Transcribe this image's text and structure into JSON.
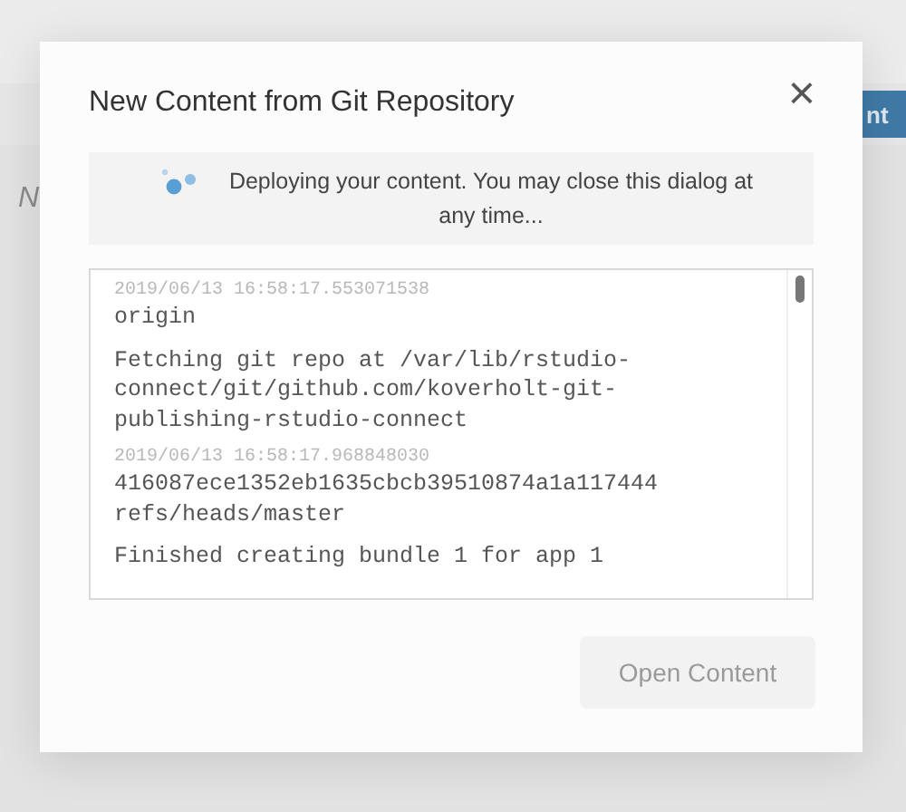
{
  "background": {
    "button_label": "nt",
    "text": "N"
  },
  "dialog": {
    "title": "New Content from Git Repository",
    "close": "×",
    "status": "Deploying your content. You may close this dialog at any time...",
    "log": [
      {
        "kind": "timestamp",
        "text": "2019/06/13 16:58:17.553071538"
      },
      {
        "kind": "message",
        "text": "origin"
      },
      {
        "kind": "message",
        "text": "Fetching git repo at /var/lib/rstudio-connect/git/github.com/koverholt-git-publishing-rstudio-connect"
      },
      {
        "kind": "timestamp",
        "text": "2019/06/13 16:58:17.968848030"
      },
      {
        "kind": "message",
        "text": "416087ece1352eb1635cbcb39510874a1a117444 refs/heads/master"
      },
      {
        "kind": "message",
        "text": "Finished creating bundle 1 for app 1"
      }
    ],
    "button": {
      "label": "Open Content",
      "disabled": true
    }
  }
}
